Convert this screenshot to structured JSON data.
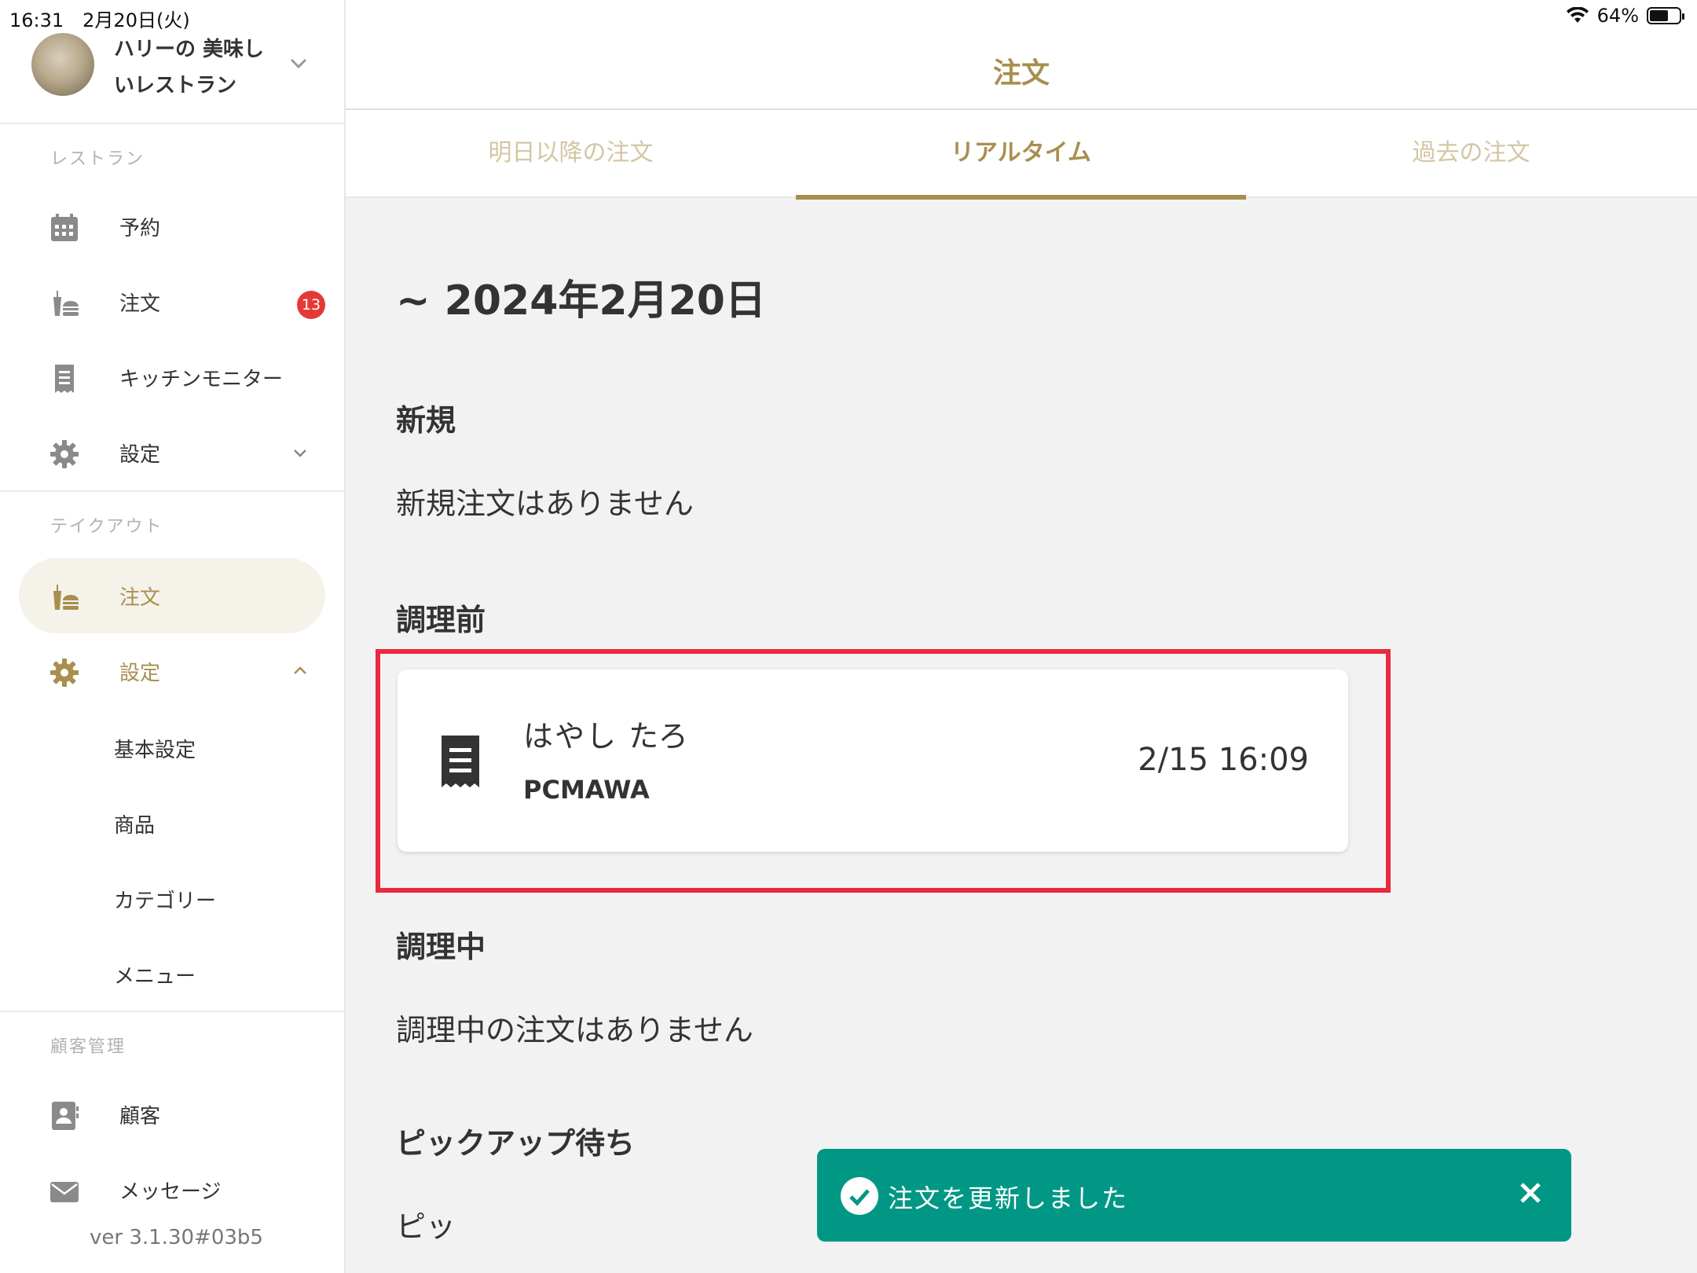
{
  "status_bar": {
    "time_date": "16:31　2月20日(火)",
    "battery": "64%",
    "battery_fraction": 0.64
  },
  "sidebar": {
    "restaurant_name": "ハリーの 美味しいレストラン",
    "sections": {
      "restaurant": "レストラン",
      "takeout": "テイクアウト",
      "customers": "顧客管理"
    },
    "restaurant_items": [
      {
        "label": "予約",
        "icon": "calendar-icon"
      },
      {
        "label": "注文",
        "icon": "burger-drink-icon",
        "badge": "13"
      },
      {
        "label": "キッチンモニター",
        "icon": "receipt-icon"
      },
      {
        "label": "設定",
        "icon": "gear-icon"
      }
    ],
    "takeout_items": [
      {
        "label": "注文",
        "icon": "burger-drink-icon",
        "active": true
      },
      {
        "label": "設定",
        "icon": "gear-icon",
        "expanded": true
      }
    ],
    "takeout_sub_items": [
      "基本設定",
      "商品",
      "カテゴリー",
      "メニュー"
    ],
    "customer_items": [
      {
        "label": "顧客",
        "icon": "contact-card-icon"
      },
      {
        "label": "メッセージ",
        "icon": "envelope-icon"
      }
    ],
    "version": "ver 3.1.30#03b5"
  },
  "main": {
    "title": "注文",
    "tabs": [
      {
        "label": "明日以降の注文",
        "active": false
      },
      {
        "label": "リアルタイム",
        "active": true
      },
      {
        "label": "過去の注文",
        "active": false
      }
    ],
    "date_heading": "~ 2024年2月20日",
    "sections": {
      "new": {
        "title": "新規",
        "empty": "新規注文はありません"
      },
      "before_cooking": {
        "title": "調理前"
      },
      "cooking": {
        "title": "調理中",
        "empty": "調理中の注文はありません"
      },
      "pickup": {
        "title": "ピックアップ待ち",
        "empty_partial": "ピッ"
      }
    },
    "order": {
      "name": "はやし たろ",
      "code": "PCMAWA",
      "time": "2/15 16:09"
    }
  },
  "toast": {
    "message": "注文を更新しました"
  },
  "colors": {
    "gold": "#a88f4e",
    "toast": "#009885",
    "highlight": "#e8293e",
    "badge": "#e53935"
  }
}
